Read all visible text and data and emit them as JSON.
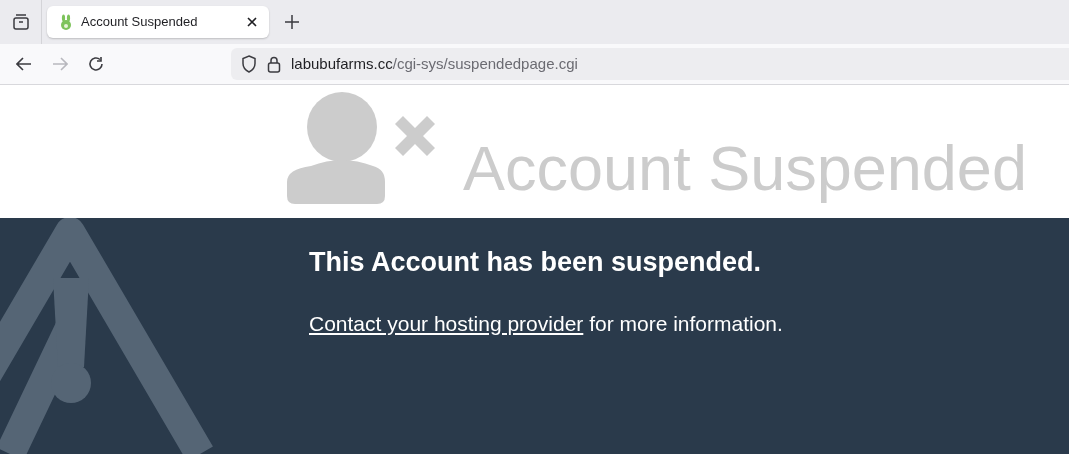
{
  "tabs": [
    {
      "title": "Account Suspended",
      "selected": true
    }
  ],
  "nav": {
    "back_disabled": false,
    "forward_disabled": true
  },
  "address_bar": {
    "domain": "labubufarms.cc",
    "path": "/cgi-sys/suspendedpage.cgi"
  },
  "page": {
    "banner_title": "Account Suspended",
    "heading": "This Account has been suspended.",
    "link": "Contact your hosting provider",
    "message_rest": " for more information."
  }
}
